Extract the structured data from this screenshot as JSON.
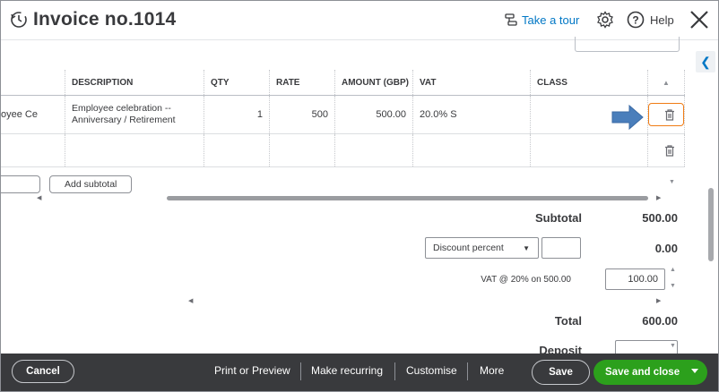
{
  "header": {
    "title": "Invoice no.1014",
    "tour_label": "Take a tour",
    "help_label": "Help"
  },
  "table": {
    "columns": [
      "DESCRIPTION",
      "QTY",
      "RATE",
      "AMOUNT (GBP)",
      "VAT",
      "CLASS"
    ],
    "rows": [
      {
        "product": "oyee Ce",
        "description_line1": "Employee celebration --",
        "description_line2": "Anniversary / Retirement",
        "qty": "1",
        "rate": "500",
        "amount": "500.00",
        "vat": "20.0% S",
        "class": ""
      }
    ],
    "add_subtotal_label": "Add subtotal"
  },
  "summary": {
    "subtotal_label": "Subtotal",
    "subtotal_value": "500.00",
    "discount_select": "Discount percent",
    "discount_value": "0.00",
    "vat_label": "VAT @ 20% on 500.00",
    "vat_value": "100.00",
    "total_label": "Total",
    "total_value": "600.00",
    "deposit_label": "Deposit"
  },
  "footer": {
    "cancel": "Cancel",
    "print_preview": "Print or Preview",
    "make_recurring": "Make recurring",
    "customise": "Customise",
    "more": "More",
    "save": "Save",
    "save_close": "Save and close"
  },
  "colors": {
    "accent": "#0077c5",
    "highlight": "#f07c14",
    "arrow": "#4a7ebb",
    "save_green": "#2ca01c",
    "footer_bg": "#393a3d"
  },
  "icons": [
    "history-icon",
    "tour-icon",
    "gear-icon",
    "help-icon",
    "close-icon",
    "trash-icon",
    "arrow-annotation-icon",
    "chevron-left-icon"
  ]
}
